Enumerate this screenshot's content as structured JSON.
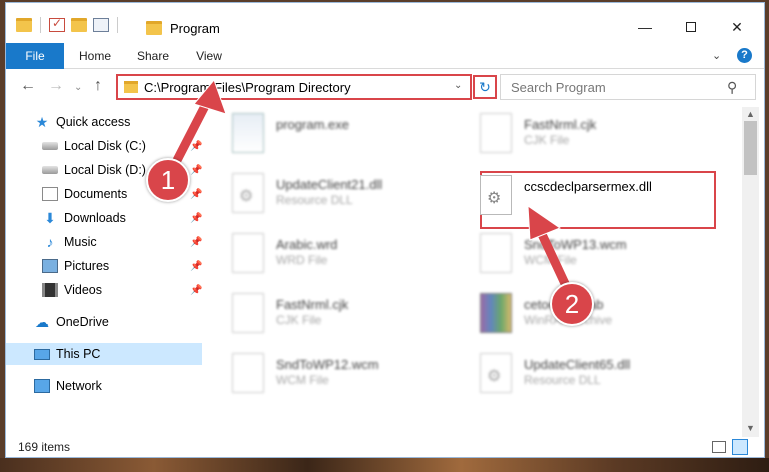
{
  "window": {
    "title": "Program",
    "minimize": "—",
    "maximize": "",
    "close": "✕"
  },
  "ribbon": {
    "tabs": [
      "File",
      "Home",
      "Share",
      "View"
    ],
    "help": "?"
  },
  "navigation": {
    "address": "C:\\Program Files\\Program Directory",
    "search_placeholder": "Search Program"
  },
  "sidebar": {
    "items": [
      {
        "label": "Quick access",
        "icon": "star-icon"
      },
      {
        "label": "Local Disk (C:)",
        "icon": "disk-icon",
        "pinned": true
      },
      {
        "label": "Local Disk (D:)",
        "icon": "disk-icon",
        "pinned": true
      },
      {
        "label": "Documents",
        "icon": "documents-icon",
        "pinned": true
      },
      {
        "label": "Downloads",
        "icon": "download-icon",
        "pinned": true
      },
      {
        "label": "Music",
        "icon": "music-icon",
        "pinned": true
      },
      {
        "label": "Pictures",
        "icon": "pictures-icon",
        "pinned": true
      },
      {
        "label": "Videos",
        "icon": "videos-icon",
        "pinned": true
      },
      {
        "label": "OneDrive",
        "icon": "onedrive-icon"
      },
      {
        "label": "This PC",
        "icon": "computer-icon",
        "selected": true
      },
      {
        "label": "Network",
        "icon": "network-icon"
      }
    ]
  },
  "files": [
    {
      "name": "program.exe",
      "type": ""
    },
    {
      "name": "FastNrml.cjk",
      "type": "CJK File"
    },
    {
      "name": "UpdateClient21.dll",
      "type": "Resource DLL"
    },
    {
      "name": "ccscdeclparsermex.dll",
      "type": ""
    },
    {
      "name": "Arabic.wrd",
      "type": "WRD File"
    },
    {
      "name": "SndToWP13.wcm",
      "type": "WCM File"
    },
    {
      "name": "FastNrml.cjk",
      "type": "CJK File"
    },
    {
      "name": "cetooltips.cab",
      "type": "WinRAR archive"
    },
    {
      "name": "SndToWP12.wcm",
      "type": "WCM File"
    },
    {
      "name": "UpdateClient65.dll",
      "type": "Resource DLL"
    }
  ],
  "status": {
    "item_count": "169 items"
  },
  "annotations": {
    "step1": "1",
    "step2": "2"
  },
  "colors": {
    "accent": "#1979ca",
    "annotation": "#d9454a",
    "selection": "#cce8ff"
  }
}
